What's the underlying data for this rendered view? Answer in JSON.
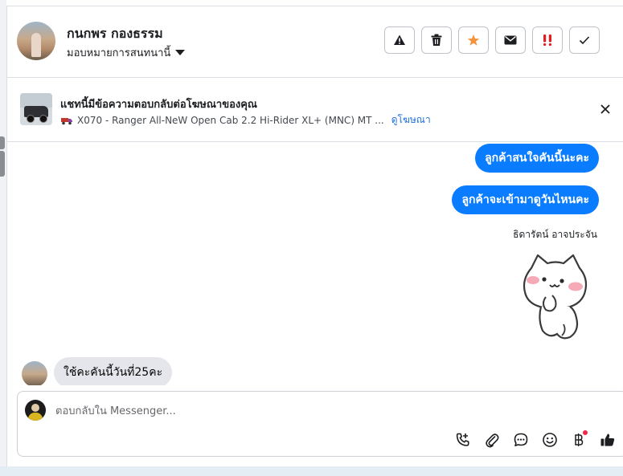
{
  "header": {
    "contact_name": "กนกพร กองธรรม",
    "assign_label": "มอบหมายการสนทนานี้"
  },
  "toolbar": {
    "buttons": [
      {
        "name": "report-spam-button",
        "icon": "warning-icon"
      },
      {
        "name": "delete-button",
        "icon": "trash-icon"
      },
      {
        "name": "star-button",
        "icon": "star-icon",
        "color": "#f5923e"
      },
      {
        "name": "mark-unread-button",
        "icon": "envelope-icon"
      },
      {
        "name": "follow-up-button",
        "icon": "double-exclamation-icon",
        "color": "#e02020"
      },
      {
        "name": "mark-done-button",
        "icon": "check-icon"
      }
    ]
  },
  "ad_banner": {
    "title": "แชทนี้มีข้อความตอบกลับต่อโฆษณาของคุณ",
    "ad_name": "X070 - Ranger All-NeW Open Cab 2.2 Hi-Rider XL+ (MNC) MT ...",
    "ad_link": "ดูโฆษณา"
  },
  "messages": {
    "outgoing": [
      "ลูกค้าสนใจคันนี้นะคะ",
      "ลูกค้าจะเข้ามาดูวันไหนคะ"
    ],
    "sender_name": "ธิดารัตน์ อาจประจัน",
    "incoming": "ใช้คะคันนี้วันที่25คะ"
  },
  "composer": {
    "placeholder": "ตอบกลับใน Messenger..."
  },
  "colors": {
    "accent": "#0a7cff",
    "link": "#216fdb",
    "incoming_bubble": "#e4e6eb"
  }
}
